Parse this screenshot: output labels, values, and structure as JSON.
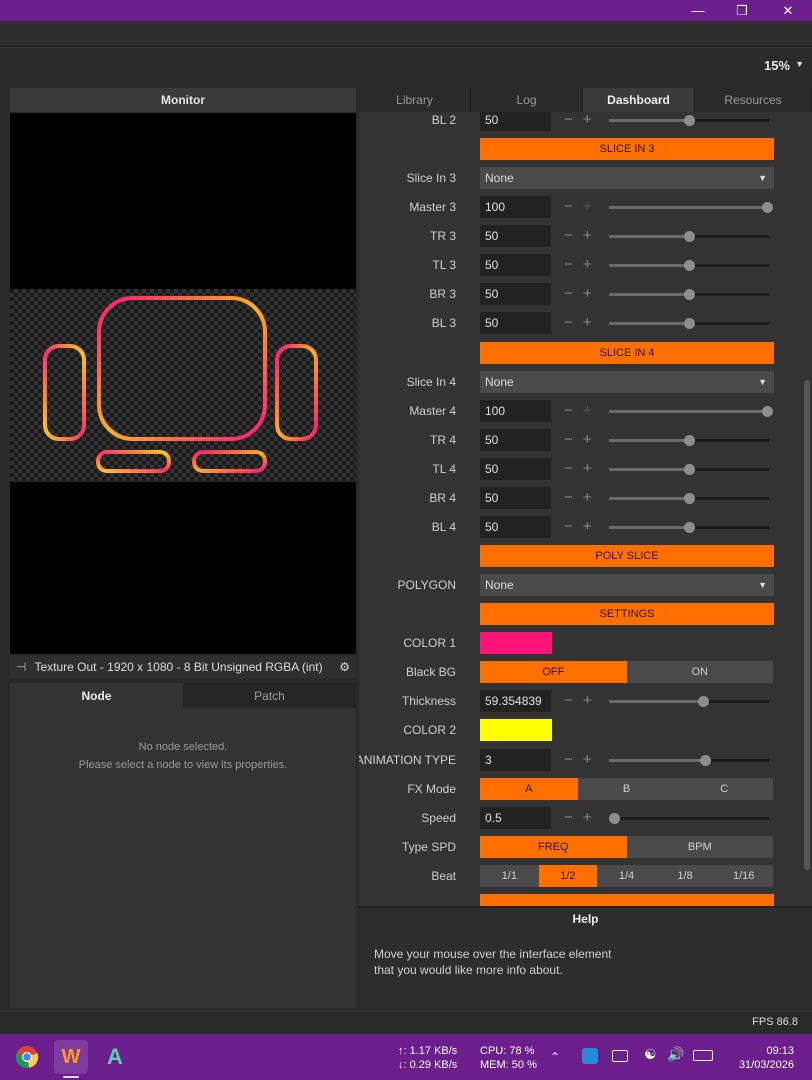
{
  "titlebar": {
    "minimize_icon": "minimize-icon",
    "restore_icon": "restore-icon",
    "close_icon": "close-icon"
  },
  "toolbar": {
    "zoom": "15%"
  },
  "monitor": {
    "header": "Monitor",
    "texture_out": "Texture Out - 1920 x 1080 - 8 Bit Unsigned RGBA (int)"
  },
  "left_tabs": [
    {
      "label": "Node"
    },
    {
      "label": "Patch"
    }
  ],
  "node_panel": {
    "line1": "No node selected.",
    "line2": "Please select a node to view its properties."
  },
  "right_tabs": [
    {
      "label": "Library"
    },
    {
      "label": "Log"
    },
    {
      "label": "Dashboard"
    },
    {
      "label": "Resources"
    }
  ],
  "dashboard": {
    "bl2": {
      "label": "BL 2",
      "value": "50"
    },
    "slice_in_3_header": "SLICE IN 3",
    "slice_in_3": {
      "label": "Slice In 3",
      "value": "None"
    },
    "master3": {
      "label": "Master 3",
      "value": "100"
    },
    "tr3": {
      "label": "TR 3",
      "value": "50"
    },
    "tl3": {
      "label": "TL 3",
      "value": "50"
    },
    "br3": {
      "label": "BR 3",
      "value": "50"
    },
    "bl3": {
      "label": "BL 3",
      "value": "50"
    },
    "slice_in_4_header": "SLICE IN 4",
    "slice_in_4": {
      "label": "Slice In 4",
      "value": "None"
    },
    "master4": {
      "label": "Master 4",
      "value": "100"
    },
    "tr4": {
      "label": "TR 4",
      "value": "50"
    },
    "tl4": {
      "label": "TL 4",
      "value": "50"
    },
    "br4": {
      "label": "BR 4",
      "value": "50"
    },
    "bl4": {
      "label": "BL 4",
      "value": "50"
    },
    "poly_slice_header": "POLY SLICE",
    "polygon": {
      "label": "POLYGON",
      "value": "None"
    },
    "settings_header": "SETTINGS",
    "color1": {
      "label": "COLOR 1",
      "color": "#ff1577"
    },
    "black_bg": {
      "label": "Black BG",
      "off": "OFF",
      "on": "ON"
    },
    "thickness": {
      "label": "Thickness",
      "value": "59.354839"
    },
    "color2": {
      "label": "COLOR 2",
      "color": "#ffff00"
    },
    "animation_type": {
      "label": "ANIMATION TYPE",
      "value": "3"
    },
    "fx_mode": {
      "label": "FX Mode",
      "a": "A",
      "b": "B",
      "c": "C"
    },
    "speed": {
      "label": "Speed",
      "value": "0.5"
    },
    "type_spd": {
      "label": "Type SPD",
      "freq": "FREQ",
      "bpm": "BPM"
    },
    "beat": {
      "label": "Beat",
      "options": [
        "1/1",
        "1/2",
        "1/4",
        "1/8",
        "1/16"
      ]
    }
  },
  "help": {
    "title": "Help",
    "line1": "Move your mouse over the interface element",
    "line2": "that you would like more info about."
  },
  "status": {
    "fps": "FPS 86.8"
  },
  "taskbar": {
    "net_up": "↑: 1.17 KB/s",
    "net_down": "↓: 0.29 KB/s",
    "cpu": "CPU: 78 %",
    "mem": "MEM: 50 %",
    "time": "09:13",
    "date": "31/03/2026"
  },
  "colors": {
    "accent": "#ff6f00",
    "titlebar": "#6b1e8c"
  }
}
